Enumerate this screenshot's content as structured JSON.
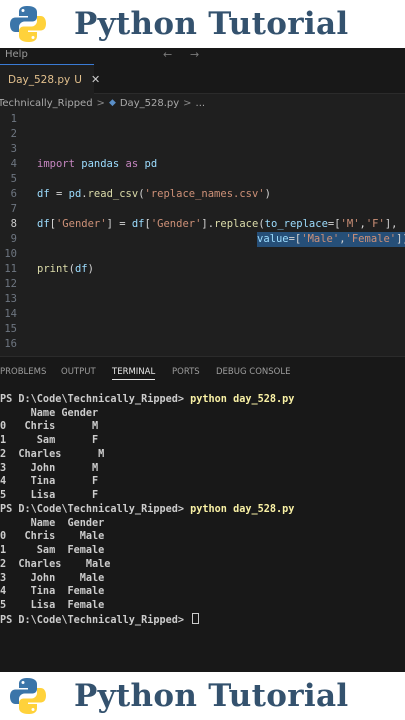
{
  "banner": {
    "title": "Python Tutorial"
  },
  "menubar": {
    "help": "Help",
    "back": "←",
    "forward": "→"
  },
  "tab": {
    "filename": "Day_528.py",
    "status": "U",
    "close": "✕"
  },
  "breadcrumb": {
    "folder": "Technically_Ripped",
    "sep": ">",
    "file": "Day_528.py",
    "more": "..."
  },
  "editor": {
    "line_numbers": [
      "1",
      "2",
      "3",
      "4",
      "5",
      "6",
      "7",
      "8",
      "9",
      "10",
      "11",
      "12",
      "13",
      "14",
      "15",
      "16"
    ],
    "line1": {
      "import": "import",
      "module": "pandas",
      "as": "as",
      "alias": "pd"
    },
    "line5": {
      "df": "df",
      "eq": " = ",
      "pd": "pd",
      "dot": ".",
      "fn": "read_csv",
      "open": "(",
      "arg": "'replace_names.csv'",
      "close": ")"
    },
    "line7": {
      "df1": "df",
      "b1": "[",
      "k1": "'Gender'",
      "b2": "] = ",
      "df2": "df",
      "b3": "[",
      "k2": "'Gender'",
      "b4": "].",
      "fn": "replace",
      "open": "(",
      "param": "to_replace",
      "eq": "=[",
      "m": "'M'",
      "comma": ",",
      "f": "'F'",
      "end": "],"
    },
    "line8": {
      "param": "value",
      "eq": "=[",
      "male": "'Male'",
      "comma": ",",
      "female": "'Female'",
      "end": "])"
    },
    "line10": {
      "fn": "print",
      "open": "(",
      "arg": "df",
      "close": ")"
    }
  },
  "panel": {
    "tabs": [
      "PROBLEMS",
      "OUTPUT",
      "TERMINAL",
      "PORTS",
      "DEBUG CONSOLE"
    ],
    "active": "TERMINAL"
  },
  "terminal": {
    "prompt": "PS D:\\Code\\Technically_Ripped> ",
    "command": "python day_528.py",
    "run1": [
      "     Name Gender",
      "0   Chris      M",
      "1     Sam      F",
      "2  Charles      M",
      "3    John      M",
      "4    Tina      F",
      "5    Lisa      F"
    ],
    "run2": [
      "     Name  Gender",
      "0   Chris    Male",
      "1     Sam  Female",
      "2  Charles    Male",
      "3    John    Male",
      "4    Tina  Female",
      "5    Lisa  Female"
    ]
  },
  "colors": {
    "python_blue": "#3b75a9",
    "python_yellow": "#ffd23b",
    "title_color": "#34526e",
    "accent": "#3a7bd5"
  }
}
